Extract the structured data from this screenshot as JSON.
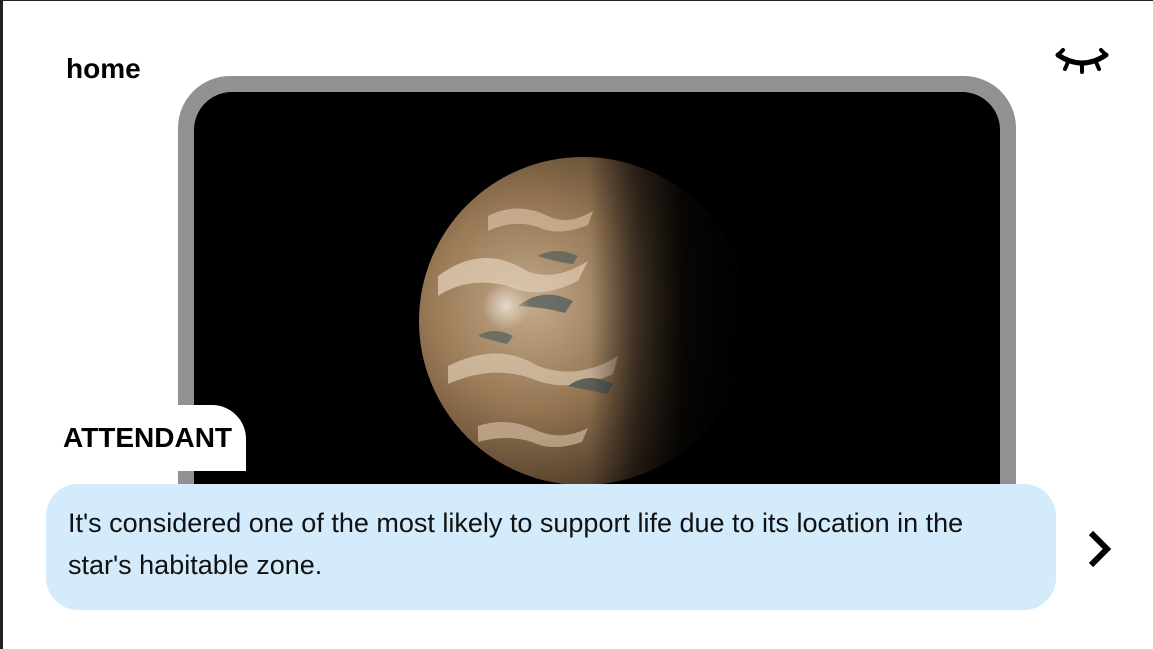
{
  "nav": {
    "home_label": "home",
    "hide_icon": "closed-eye-icon"
  },
  "scene": {
    "image_subject": "planet"
  },
  "dialog": {
    "speaker": "ATTENDANT",
    "text": "It's considered one of the most likely to support life due to its location in the star's habitable zone.",
    "next_icon": "chevron-right-icon"
  },
  "colors": {
    "frame": "#929092",
    "screen": "#000000",
    "dialog_bg": "#d3ebfb",
    "text": "#000000"
  }
}
